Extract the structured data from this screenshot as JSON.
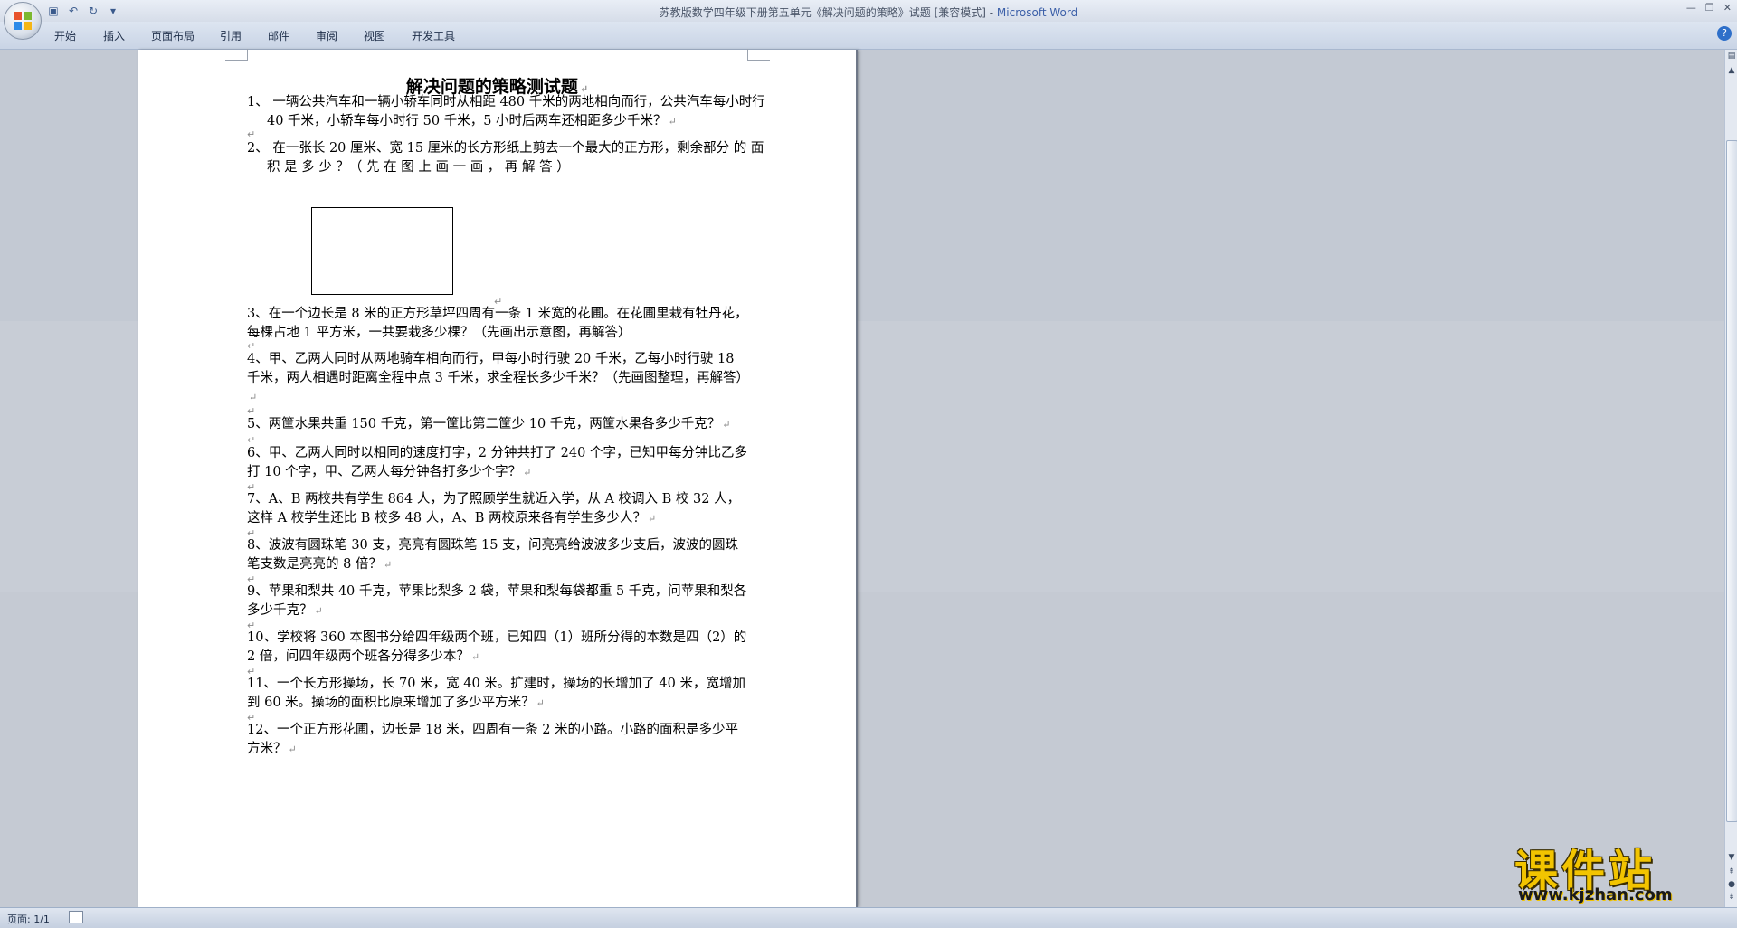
{
  "window": {
    "title_main": "苏教版数学四年级下册第五单元《解决问题的策略》试题 [兼容模式] - ",
    "title_app": "Microsoft Word",
    "controls": [
      "—",
      "❐",
      "✕"
    ]
  },
  "quick_access": {
    "icons": [
      "save-icon",
      "undo-icon",
      "redo-icon",
      "customize-icon"
    ]
  },
  "ribbon": {
    "tabs": [
      "开始",
      "插入",
      "页面布局",
      "引用",
      "邮件",
      "审阅",
      "视图",
      "开发工具"
    ],
    "help": "?"
  },
  "document": {
    "heading": "解决问题的策略测试题",
    "paragraph_mark": "↵",
    "questions": [
      "1、 一辆公共汽车和一辆小轿车同时从相距 480 千米的两地相向而行，公共汽车每小时行 40 千米，小轿车每小时行 50 千米，5 小时后两车还相距多少千米？",
      "2、 在一张长 20 厘米、宽 15 厘米的长方形纸上剪去一个最大的正方形，剩余部分 的 面 积 是 多 少 ？（ 先 在 图 上 画 一 画 ， 再 解 答 ）",
      "3、在一个边长是 8 米的正方形草坪四周有一条 1 米宽的花圃。在花圃里栽有牡丹花，每棵占地 1 平方米，一共要栽多少棵？（先画出示意图，再解答）",
      "4、甲、乙两人同时从两地骑车相向而行，甲每小时行驶 20 千米，乙每小时行驶 18 千米，两人相遇时距离全程中点 3 千米，求全程长多少千米？（先画图整理，再解答）",
      "5、两筐水果共重 150 千克，第一筐比第二筐少 10 千克，两筐水果各多少千克？",
      "6、甲、乙两人同时以相同的速度打字，2 分钟共打了 240 个字，已知甲每分钟比乙多打 10 个字，甲、乙两人每分钟各打多少个字？",
      "7、A、B 两校共有学生 864 人，为了照顾学生就近入学，从 A 校调入 B 校 32 人，这样 A 校学生还比 B 校多 48 人，A、B 两校原来各有学生多少人？",
      "8、波波有圆珠笔 30 支，亮亮有圆珠笔 15 支，问亮亮给波波多少支后，波波的圆珠笔支数是亮亮的 8 倍？",
      "9、苹果和梨共 40 千克，苹果比梨多 2 袋，苹果和梨每袋都重 5 千克，问苹果和梨各多少千克？",
      "10、学校将 360 本图书分给四年级两个班，已知四（1）班所分得的本数是四（2）的 2 倍，问四年级两个班各分得多少本？",
      "11、一个长方形操场，长 70 米，宽 40 米。扩建时，操场的长增加了 40 米，宽增加到 60 米。操场的面积比原来增加了多少平方米？",
      "12、一个正方形花圃，边长是 18 米，四周有一条 2 米的小路。小路的面积是多少平方米？"
    ]
  },
  "status": {
    "page": "页面: 1/1"
  },
  "watermark": {
    "title": "课件站",
    "url": "www.kjzhan.com"
  },
  "colors": {
    "app_title": "#3b5fa8",
    "workspace": "#c6ccd6",
    "watermark": "#f2c400"
  }
}
